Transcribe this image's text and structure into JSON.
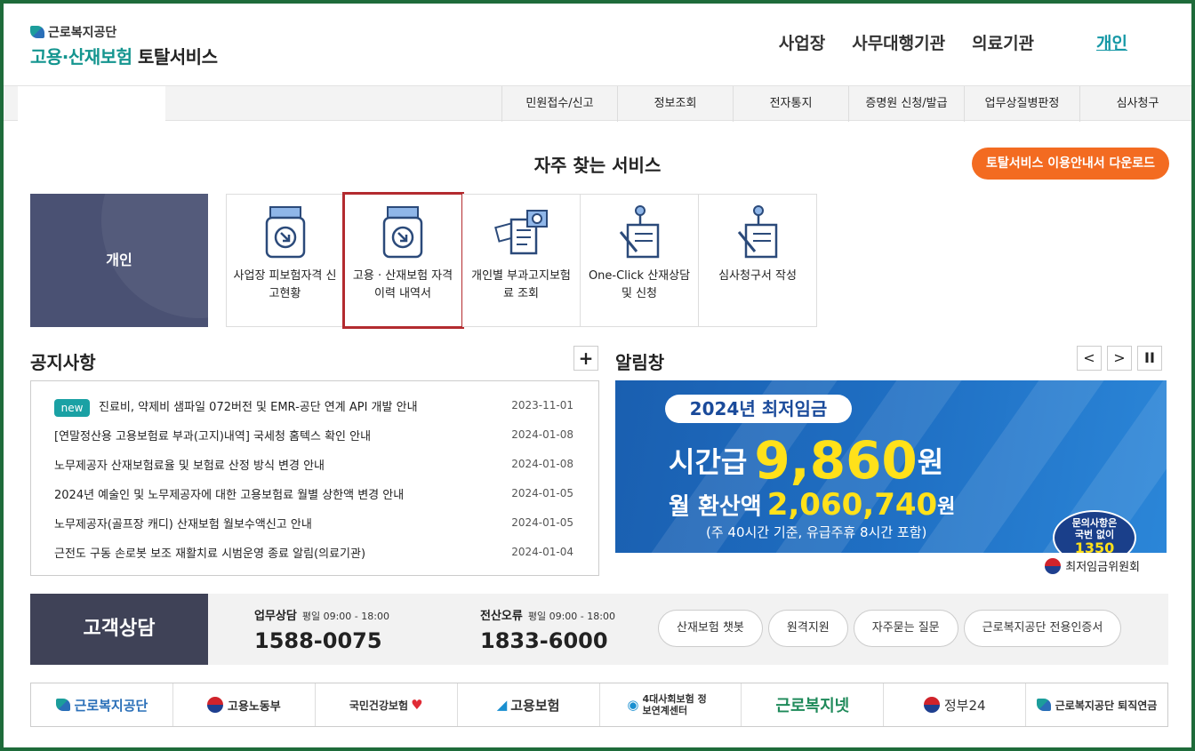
{
  "header": {
    "org_small": "근로복지공단",
    "title_teal": "고용·산재보험",
    "title_dark": "토탈서비스",
    "gnb": [
      "사업장",
      "사무대행기관",
      "의료기관",
      "개인"
    ]
  },
  "nav": {
    "menus": [
      "민원접수/신고",
      "정보조회",
      "전자통지",
      "증명원 신청/발급",
      "업무상질병판정",
      "심사청구"
    ]
  },
  "frequent": {
    "title": "자주 찾는 서비스",
    "guide_button": "토탈서비스 이용안내서 다운로드",
    "category": "개인",
    "services": [
      {
        "label": "사업장 피보험자격 신고현황",
        "icon": "document-download-icon"
      },
      {
        "label": "고용 · 산재보험 자격 이력 내역서",
        "icon": "document-download-icon"
      },
      {
        "label": "개인별 부과고지보험료 조회",
        "icon": "document-search-icon"
      },
      {
        "label": "One-Click 산재상담 및 신청",
        "icon": "pen-document-icon"
      },
      {
        "label": "심사청구서 작성",
        "icon": "pen-document-icon"
      }
    ]
  },
  "notice": {
    "title": "공지사항",
    "more": "+",
    "new_badge": "new",
    "items": [
      {
        "text": "진료비, 약제비 샘파일 072버전 및 EMR-공단 연계 API 개발 안내",
        "date": "2023-11-01"
      },
      {
        "text": "[연말정산용 고용보험료 부과(고지)내역] 국세청 홈텍스 확인 안내",
        "date": "2024-01-08"
      },
      {
        "text": "노무제공자 산재보험료율 및 보험료 산정 방식 변경 안내",
        "date": "2024-01-08"
      },
      {
        "text": "2024년 예술인 및 노무제공자에 대한 고용보험료 월별 상한액 변경 안내",
        "date": "2024-01-05"
      },
      {
        "text": "노무제공자(골프장 캐디) 산재보험 월보수액신고 안내",
        "date": "2024-01-05"
      },
      {
        "text": "근전도 구동 손로봇 보조 재활치료 시범운영 종료 알림(의료기관)",
        "date": "2024-01-04"
      }
    ]
  },
  "alert": {
    "title": "알림창",
    "prev": "<",
    "next": ">",
    "pause": "II",
    "banner": {
      "pill": "2024년 최저임금",
      "hourly_label": "시간급",
      "hourly_value": "9,860",
      "won": "원",
      "monthly_label": "월 환산액",
      "monthly_value": "2,060,740",
      "note": "(주 40시간 기준, 유급주휴 8시간 포함)",
      "bubble_line1": "문의사항은",
      "bubble_line2": "국번 없이",
      "bubble_number": "1350",
      "source": "최저임금위원회"
    }
  },
  "customer": {
    "label": "고객상담",
    "work": {
      "title": "업무상담",
      "time": "평일 09:00 - 18:00",
      "number": "1588-0075"
    },
    "error": {
      "title": "전산오류",
      "time": "평일 09:00 - 18:00",
      "number": "1833-6000"
    },
    "buttons": [
      "산재보험 챗봇",
      "원격지원",
      "자주묻는 질문",
      "근로복지공단 전용인증서"
    ]
  },
  "logos": [
    "근로복지공단",
    "고용노동부",
    "국민건강보험",
    "고용보험",
    "4대사회보험 정보연계센터",
    "근로복지넷",
    "정부24",
    "근로복지공단 퇴직연금"
  ],
  "colors": {
    "accent": "#1698a6",
    "orange": "#f36b21",
    "selected": "#b32b2f",
    "frame": "#1e6b3a"
  }
}
